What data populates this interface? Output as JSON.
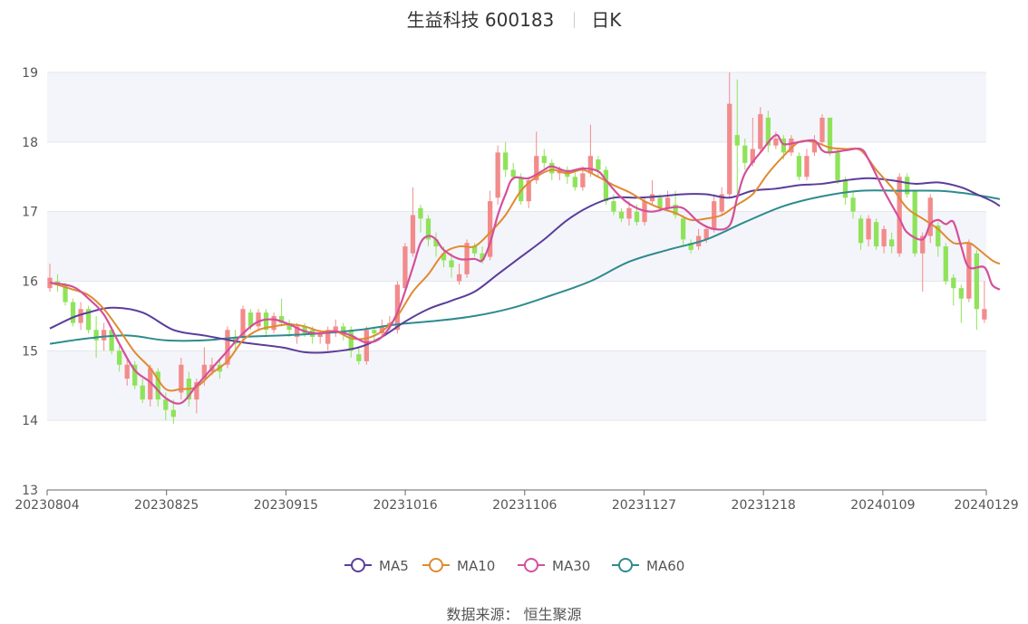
{
  "header": {
    "title": "生益科技 600183",
    "period": "日K"
  },
  "source": {
    "label": "数据来源：",
    "value": "恒生聚源"
  },
  "chart_data": {
    "type": "candlestick",
    "ylim": [
      13,
      19
    ],
    "y_ticks": [
      13,
      14,
      15,
      16,
      17,
      18,
      19
    ],
    "x_tick_labels": [
      "20230804",
      "20230825",
      "20230915",
      "20231016",
      "20231106",
      "20231127",
      "20231218",
      "20240109",
      "20240129"
    ],
    "x_tick_indices": [
      0,
      15,
      30,
      45,
      60,
      75,
      90,
      105,
      118
    ],
    "legend": [
      {
        "name": "MA5",
        "color": "#5b3d9a"
      },
      {
        "name": "MA10",
        "color": "#e08a32"
      },
      {
        "name": "MA30",
        "color": "#d4509a"
      },
      {
        "name": "MA60",
        "color": "#2e8b8e"
      }
    ],
    "up_color": "#f28b8b",
    "down_color": "#8fe35a",
    "candles": [
      [
        15.9,
        16.05,
        16.25,
        15.85
      ],
      [
        16.0,
        15.95,
        16.1,
        15.85
      ],
      [
        15.95,
        15.7,
        15.98,
        15.65
      ],
      [
        15.7,
        15.4,
        15.75,
        15.35
      ],
      [
        15.4,
        15.6,
        15.7,
        15.3
      ],
      [
        15.6,
        15.3,
        15.65,
        15.25
      ],
      [
        15.3,
        15.15,
        15.5,
        14.9
      ],
      [
        15.15,
        15.3,
        15.4,
        15.0
      ],
      [
        15.3,
        15.0,
        15.35,
        14.95
      ],
      [
        15.0,
        14.8,
        15.1,
        14.7
      ],
      [
        14.6,
        14.8,
        14.9,
        14.5
      ],
      [
        14.8,
        14.5,
        14.85,
        14.45
      ],
      [
        14.5,
        14.3,
        14.6,
        14.25
      ],
      [
        14.3,
        14.75,
        14.8,
        14.2
      ],
      [
        14.7,
        14.3,
        14.75,
        14.2
      ],
      [
        14.3,
        14.15,
        14.4,
        14.0
      ],
      [
        14.15,
        14.05,
        14.3,
        13.95
      ],
      [
        14.4,
        14.8,
        14.9,
        14.3
      ],
      [
        14.6,
        14.3,
        14.7,
        14.2
      ],
      [
        14.3,
        14.55,
        14.6,
        14.1
      ],
      [
        14.6,
        14.8,
        15.05,
        14.5
      ],
      [
        14.7,
        14.8,
        14.9,
        14.65
      ],
      [
        14.8,
        14.7,
        14.9,
        14.6
      ],
      [
        14.8,
        15.3,
        15.35,
        14.75
      ],
      [
        15.2,
        15.1,
        15.3,
        15.0
      ],
      [
        15.2,
        15.6,
        15.65,
        15.15
      ],
      [
        15.55,
        15.35,
        15.6,
        15.3
      ],
      [
        15.35,
        15.55,
        15.6,
        15.3
      ],
      [
        15.55,
        15.3,
        15.6,
        15.2
      ],
      [
        15.3,
        15.5,
        15.55,
        15.25
      ],
      [
        15.5,
        15.4,
        15.75,
        15.35
      ],
      [
        15.4,
        15.3,
        15.45,
        15.2
      ],
      [
        15.2,
        15.35,
        15.4,
        15.1
      ],
      [
        15.35,
        15.25,
        15.4,
        15.2
      ],
      [
        15.3,
        15.2,
        15.35,
        15.1
      ],
      [
        15.2,
        15.25,
        15.3,
        15.1
      ],
      [
        15.1,
        15.3,
        15.35,
        15.0
      ],
      [
        15.25,
        15.35,
        15.45,
        15.2
      ],
      [
        15.35,
        15.25,
        15.4,
        15.15
      ],
      [
        15.3,
        15.0,
        15.35,
        14.9
      ],
      [
        14.95,
        14.85,
        15.05,
        14.8
      ],
      [
        14.85,
        15.3,
        15.35,
        14.8
      ],
      [
        15.3,
        15.25,
        15.35,
        15.15
      ],
      [
        15.25,
        15.35,
        15.45,
        15.2
      ],
      [
        15.35,
        15.4,
        15.5,
        15.3
      ],
      [
        15.3,
        15.95,
        16.0,
        15.25
      ],
      [
        15.9,
        16.5,
        16.55,
        15.85
      ],
      [
        16.4,
        16.95,
        17.35,
        16.35
      ],
      [
        17.05,
        16.9,
        17.1,
        16.7
      ],
      [
        16.9,
        16.6,
        16.95,
        16.5
      ],
      [
        16.6,
        16.5,
        16.7,
        16.35
      ],
      [
        16.4,
        16.3,
        16.5,
        16.2
      ],
      [
        16.3,
        16.2,
        16.4,
        16.05
      ],
      [
        16.0,
        16.1,
        16.25,
        15.95
      ],
      [
        16.1,
        16.55,
        16.6,
        16.05
      ],
      [
        16.5,
        16.4,
        16.55,
        16.35
      ],
      [
        16.4,
        16.3,
        16.5,
        16.25
      ],
      [
        16.35,
        17.15,
        17.3,
        16.3
      ],
      [
        17.2,
        17.85,
        17.95,
        17.1
      ],
      [
        17.85,
        17.6,
        18.0,
        17.5
      ],
      [
        17.6,
        17.5,
        17.7,
        17.45
      ],
      [
        17.5,
        17.15,
        17.55,
        17.1
      ],
      [
        17.15,
        17.45,
        17.5,
        17.05
      ],
      [
        17.45,
        17.8,
        18.15,
        17.4
      ],
      [
        17.8,
        17.7,
        17.9,
        17.6
      ],
      [
        17.7,
        17.55,
        17.75,
        17.45
      ],
      [
        17.55,
        17.6,
        17.65,
        17.45
      ],
      [
        17.6,
        17.5,
        17.65,
        17.4
      ],
      [
        17.5,
        17.35,
        17.6,
        17.3
      ],
      [
        17.35,
        17.55,
        17.65,
        17.3
      ],
      [
        17.55,
        17.8,
        18.25,
        17.5
      ],
      [
        17.75,
        17.6,
        17.8,
        17.5
      ],
      [
        17.6,
        17.15,
        17.65,
        17.1
      ],
      [
        17.15,
        17.0,
        17.25,
        16.95
      ],
      [
        17.0,
        16.9,
        17.05,
        16.85
      ],
      [
        16.9,
        17.05,
        17.15,
        16.8
      ],
      [
        17.0,
        16.85,
        17.1,
        16.8
      ],
      [
        16.85,
        17.15,
        17.2,
        16.8
      ],
      [
        17.15,
        17.25,
        17.45,
        17.1
      ],
      [
        17.2,
        17.05,
        17.25,
        17.0
      ],
      [
        17.05,
        17.2,
        17.3,
        17.0
      ],
      [
        17.1,
        16.95,
        17.3,
        16.9
      ],
      [
        16.9,
        16.6,
        16.95,
        16.5
      ],
      [
        16.55,
        16.45,
        16.6,
        16.4
      ],
      [
        16.5,
        16.65,
        16.75,
        16.45
      ],
      [
        16.6,
        16.75,
        16.8,
        16.55
      ],
      [
        16.75,
        17.15,
        17.25,
        16.7
      ],
      [
        17.0,
        17.25,
        17.35,
        16.95
      ],
      [
        17.25,
        18.55,
        19.0,
        17.2
      ],
      [
        18.1,
        17.95,
        18.9,
        17.2
      ],
      [
        17.95,
        17.7,
        18.05,
        17.6
      ],
      [
        17.7,
        17.9,
        18.35,
        17.65
      ],
      [
        17.9,
        18.4,
        18.5,
        17.85
      ],
      [
        18.35,
        17.95,
        18.45,
        17.85
      ],
      [
        17.95,
        18.05,
        18.15,
        17.9
      ],
      [
        18.05,
        17.85,
        18.1,
        17.75
      ],
      [
        17.85,
        18.05,
        18.1,
        17.8
      ],
      [
        17.8,
        17.5,
        17.85,
        17.45
      ],
      [
        17.5,
        17.8,
        17.9,
        17.45
      ],
      [
        17.85,
        18.0,
        18.1,
        17.8
      ],
      [
        18.0,
        18.35,
        18.4,
        17.95
      ],
      [
        18.35,
        17.85,
        18.35,
        17.8
      ],
      [
        17.85,
        17.45,
        17.9,
        17.4
      ],
      [
        17.45,
        17.2,
        17.5,
        17.1
      ],
      [
        17.2,
        17.0,
        17.3,
        16.9
      ],
      [
        16.9,
        16.55,
        16.95,
        16.45
      ],
      [
        16.6,
        16.9,
        16.95,
        16.5
      ],
      [
        16.85,
        16.5,
        16.9,
        16.45
      ],
      [
        16.5,
        16.75,
        16.8,
        16.4
      ],
      [
        16.6,
        16.5,
        16.7,
        16.4
      ],
      [
        16.4,
        17.5,
        17.55,
        16.35
      ],
      [
        17.5,
        17.25,
        17.55,
        17.2
      ],
      [
        17.3,
        16.4,
        17.3,
        16.35
      ],
      [
        16.4,
        16.65,
        16.7,
        15.85
      ],
      [
        16.65,
        17.2,
        17.25,
        16.55
      ],
      [
        16.8,
        16.5,
        16.85,
        16.35
      ],
      [
        16.5,
        16.0,
        16.55,
        15.95
      ],
      [
        16.05,
        15.9,
        16.1,
        15.65
      ],
      [
        15.9,
        15.75,
        15.95,
        15.4
      ],
      [
        15.75,
        16.55,
        16.6,
        15.7
      ],
      [
        16.4,
        15.6,
        16.45,
        15.3
      ],
      [
        15.45,
        15.6,
        16.0,
        15.4
      ]
    ],
    "ma5": [
      [
        0,
        15.98
      ],
      [
        3,
        15.92
      ],
      [
        5,
        15.75
      ],
      [
        7,
        15.52
      ],
      [
        9,
        15.1
      ],
      [
        11,
        14.72
      ],
      [
        13,
        14.55
      ],
      [
        15,
        14.32
      ],
      [
        17,
        14.25
      ],
      [
        19,
        14.5
      ],
      [
        21,
        14.75
      ],
      [
        23,
        15.0
      ],
      [
        25,
        15.25
      ],
      [
        27,
        15.42
      ],
      [
        29,
        15.45
      ],
      [
        31,
        15.38
      ],
      [
        33,
        15.28
      ],
      [
        35,
        15.25
      ],
      [
        37,
        15.28
      ],
      [
        39,
        15.22
      ],
      [
        41,
        15.12
      ],
      [
        43,
        15.2
      ],
      [
        45,
        15.55
      ],
      [
        47,
        16.2
      ],
      [
        48,
        16.55
      ],
      [
        49,
        16.65
      ],
      [
        50,
        16.6
      ],
      [
        51,
        16.45
      ],
      [
        53,
        16.32
      ],
      [
        55,
        16.32
      ],
      [
        56,
        16.3
      ],
      [
        57,
        16.55
      ],
      [
        58,
        16.95
      ],
      [
        59,
        17.25
      ],
      [
        60,
        17.48
      ],
      [
        62,
        17.48
      ],
      [
        64,
        17.6
      ],
      [
        65,
        17.65
      ],
      [
        67,
        17.58
      ],
      [
        69,
        17.62
      ],
      [
        71,
        17.58
      ],
      [
        72,
        17.45
      ],
      [
        74,
        17.2
      ],
      [
        76,
        17.05
      ],
      [
        78,
        17.0
      ],
      [
        80,
        17.05
      ],
      [
        82,
        17.05
      ],
      [
        84,
        16.85
      ],
      [
        86,
        16.75
      ],
      [
        88,
        16.8
      ],
      [
        89,
        17.2
      ],
      [
        90,
        17.55
      ],
      [
        92,
        17.85
      ],
      [
        94,
        18.1
      ],
      [
        95,
        17.97
      ],
      [
        97,
        18.0
      ],
      [
        99,
        18.02
      ],
      [
        100,
        17.88
      ],
      [
        101,
        17.85
      ],
      [
        103,
        17.88
      ],
      [
        105,
        17.9
      ],
      [
        106,
        17.75
      ],
      [
        108,
        17.3
      ],
      [
        110,
        16.9
      ],
      [
        111,
        16.7
      ],
      [
        113,
        16.6
      ],
      [
        114,
        16.82
      ],
      [
        115,
        16.88
      ],
      [
        116,
        16.82
      ],
      [
        117,
        16.85
      ],
      [
        118,
        16.5
      ],
      [
        119,
        16.2
      ],
      [
        121,
        16.2
      ],
      [
        122,
        15.95
      ],
      [
        123,
        15.88
      ]
    ],
    "ma10": [
      [
        0,
        15.98
      ],
      [
        3,
        15.88
      ],
      [
        5,
        15.8
      ],
      [
        7,
        15.6
      ],
      [
        9,
        15.3
      ],
      [
        11,
        14.98
      ],
      [
        13,
        14.75
      ],
      [
        15,
        14.45
      ],
      [
        17,
        14.45
      ],
      [
        19,
        14.48
      ],
      [
        21,
        14.68
      ],
      [
        23,
        14.85
      ],
      [
        25,
        15.15
      ],
      [
        27,
        15.3
      ],
      [
        29,
        15.35
      ],
      [
        31,
        15.38
      ],
      [
        33,
        15.35
      ],
      [
        35,
        15.28
      ],
      [
        37,
        15.28
      ],
      [
        39,
        15.18
      ],
      [
        41,
        15.18
      ],
      [
        43,
        15.28
      ],
      [
        45,
        15.5
      ],
      [
        47,
        15.85
      ],
      [
        49,
        16.1
      ],
      [
        51,
        16.4
      ],
      [
        53,
        16.5
      ],
      [
        55,
        16.5
      ],
      [
        57,
        16.7
      ],
      [
        59,
        16.95
      ],
      [
        61,
        17.3
      ],
      [
        63,
        17.5
      ],
      [
        65,
        17.6
      ],
      [
        67,
        17.55
      ],
      [
        69,
        17.6
      ],
      [
        71,
        17.5
      ],
      [
        73,
        17.38
      ],
      [
        75,
        17.28
      ],
      [
        77,
        17.15
      ],
      [
        79,
        17.05
      ],
      [
        81,
        16.98
      ],
      [
        83,
        16.88
      ],
      [
        85,
        16.9
      ],
      [
        87,
        16.95
      ],
      [
        89,
        17.1
      ],
      [
        91,
        17.25
      ],
      [
        93,
        17.55
      ],
      [
        95,
        17.8
      ],
      [
        97,
        18.0
      ],
      [
        99,
        18.0
      ],
      [
        101,
        17.92
      ],
      [
        103,
        17.9
      ],
      [
        105,
        17.88
      ],
      [
        107,
        17.6
      ],
      [
        109,
        17.35
      ],
      [
        111,
        17.05
      ],
      [
        113,
        16.9
      ],
      [
        115,
        16.75
      ],
      [
        117,
        16.55
      ],
      [
        119,
        16.55
      ],
      [
        120,
        16.48
      ],
      [
        122,
        16.3
      ],
      [
        123,
        16.25
      ]
    ],
    "ma30": [
      [
        0,
        15.32
      ],
      [
        3,
        15.48
      ],
      [
        5,
        15.55
      ],
      [
        8,
        15.62
      ],
      [
        12,
        15.55
      ],
      [
        16,
        15.3
      ],
      [
        20,
        15.22
      ],
      [
        25,
        15.12
      ],
      [
        30,
        15.05
      ],
      [
        33,
        14.98
      ],
      [
        36,
        14.98
      ],
      [
        40,
        15.05
      ],
      [
        43,
        15.2
      ],
      [
        46,
        15.42
      ],
      [
        49,
        15.6
      ],
      [
        52,
        15.72
      ],
      [
        55,
        15.85
      ],
      [
        58,
        16.1
      ],
      [
        61,
        16.35
      ],
      [
        64,
        16.6
      ],
      [
        67,
        16.88
      ],
      [
        70,
        17.08
      ],
      [
        73,
        17.2
      ],
      [
        76,
        17.2
      ],
      [
        79,
        17.22
      ],
      [
        82,
        17.25
      ],
      [
        85,
        17.25
      ],
      [
        88,
        17.2
      ],
      [
        91,
        17.3
      ],
      [
        94,
        17.33
      ],
      [
        97,
        17.38
      ],
      [
        100,
        17.4
      ],
      [
        103,
        17.45
      ],
      [
        106,
        17.48
      ],
      [
        109,
        17.45
      ],
      [
        112,
        17.4
      ],
      [
        115,
        17.42
      ],
      [
        118,
        17.35
      ],
      [
        120,
        17.25
      ],
      [
        122,
        17.15
      ],
      [
        123,
        17.08
      ]
    ],
    "ma60": [
      [
        0,
        15.1
      ],
      [
        5,
        15.18
      ],
      [
        10,
        15.22
      ],
      [
        15,
        15.15
      ],
      [
        20,
        15.15
      ],
      [
        25,
        15.2
      ],
      [
        30,
        15.22
      ],
      [
        35,
        15.25
      ],
      [
        40,
        15.3
      ],
      [
        45,
        15.38
      ],
      [
        50,
        15.43
      ],
      [
        55,
        15.5
      ],
      [
        60,
        15.62
      ],
      [
        65,
        15.8
      ],
      [
        70,
        16.0
      ],
      [
        75,
        16.28
      ],
      [
        80,
        16.45
      ],
      [
        85,
        16.6
      ],
      [
        90,
        16.85
      ],
      [
        95,
        17.08
      ],
      [
        100,
        17.22
      ],
      [
        105,
        17.3
      ],
      [
        110,
        17.3
      ],
      [
        115,
        17.3
      ],
      [
        118,
        17.27
      ],
      [
        121,
        17.22
      ],
      [
        123,
        17.18
      ]
    ]
  }
}
